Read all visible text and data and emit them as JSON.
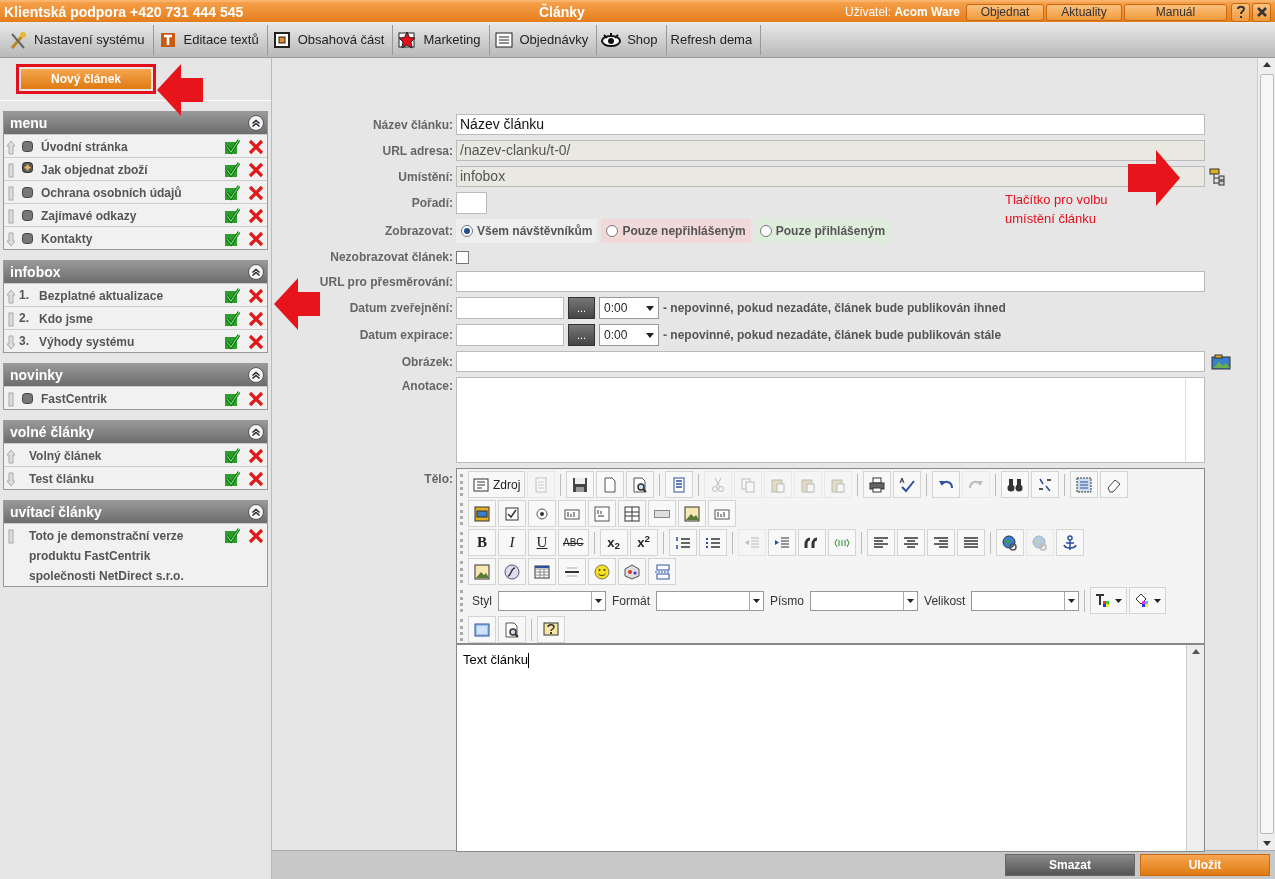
{
  "header": {
    "support": "Klientská podpora +420 731 444 545",
    "title": "Články",
    "user_label": "Uživatel:",
    "user_name": "Acom Ware",
    "buttons": [
      "Objednat",
      "Aktuality",
      "Manuál"
    ]
  },
  "menubar": [
    {
      "label": "Nastavení systému",
      "kind": "tools"
    },
    {
      "label": "Editace textů",
      "kind": "text"
    },
    {
      "label": "Obsahová část",
      "kind": "frame"
    },
    {
      "label": "Marketing",
      "kind": "star"
    },
    {
      "label": "Objednávky",
      "kind": "list"
    },
    {
      "label": "Shop",
      "kind": "eye"
    },
    {
      "label": "Refresh dema",
      "kind": "plain"
    }
  ],
  "new_button": "Nový článek",
  "groups": [
    {
      "title": "menu",
      "items": [
        {
          "kind": "bullet",
          "text": "Úvodní stránka"
        },
        {
          "kind": "plus",
          "text": "Jak objednat zboží"
        },
        {
          "kind": "bullet",
          "text": "Ochrana osobních údajů"
        },
        {
          "kind": "bullet",
          "text": "Zajímavé odkazy"
        },
        {
          "kind": "bullet",
          "text": "Kontakty"
        }
      ]
    },
    {
      "title": "infobox",
      "items": [
        {
          "kind": "number",
          "number": "1.",
          "text": "Bezplatné aktualizace"
        },
        {
          "kind": "number",
          "number": "2.",
          "text": "Kdo jsme"
        },
        {
          "kind": "number",
          "number": "3.",
          "text": "Výhody systému"
        }
      ]
    },
    {
      "title": "novinky",
      "items": [
        {
          "kind": "bullet",
          "text": "FastCentrik"
        }
      ]
    },
    {
      "title": "volné články",
      "items": [
        {
          "kind": "plain",
          "text": "Volný článek"
        },
        {
          "kind": "plain",
          "text": "Test článku"
        }
      ]
    },
    {
      "title": "uvítací články",
      "items": [
        {
          "kind": "plain",
          "text": "Toto je demonstrační verze produktu FastCentrik společnosti NetDirect s.r.o."
        }
      ]
    }
  ],
  "form": [
    {
      "kind": "text",
      "label": "Název článku:",
      "value": "Název článku"
    },
    {
      "kind": "readonly",
      "label": "URL adresa:",
      "value": "/nazev-clanku/t-0/"
    },
    {
      "kind": "location",
      "label": "Umístění:",
      "value": "infobox"
    },
    {
      "kind": "small",
      "label": "Pořadí:"
    },
    {
      "kind": "radio",
      "label": "Zobrazovat:",
      "options": [
        {
          "label": "Všem návštěvníkům",
          "selected": true,
          "color": "#eeeeee"
        },
        {
          "label": "Pouze nepřihlášeným",
          "selected": false,
          "color": "#f1d9d9"
        },
        {
          "label": "Pouze přihlášeným",
          "selected": false,
          "color": "#dfeedc"
        }
      ]
    },
    {
      "kind": "checkbox",
      "label": "Nezobrazovat článek:",
      "checked": false
    },
    {
      "kind": "text",
      "label": "URL pro přesměrování:"
    },
    {
      "kind": "date",
      "label": "Datum zveřejnění:",
      "button": "...",
      "time": "0:00",
      "note": "- nepovinné, pokud nezadáte, článek bude publikován ihned"
    },
    {
      "kind": "date",
      "label": "Datum expirace:",
      "button": "...",
      "time": "0:00",
      "note": "- nepovinné, pokud nezadáte, článek bude publikován stále"
    },
    {
      "kind": "image",
      "label": "Obrázek:"
    },
    {
      "kind": "textarea",
      "label": "Anotace:"
    }
  ],
  "callout": "Tlačítko pro volbu umístění článku",
  "editor": {
    "label": "Tělo:",
    "toolbar": [
      [
        {
          "kind": "source",
          "label": "Zdroj",
          "disabled": false
        },
        {
          "kind": "doc",
          "disabled": true
        },
        {
          "kind": "separator"
        },
        {
          "kind": "save",
          "disabled": false
        },
        {
          "kind": "page",
          "disabled": false
        },
        {
          "kind": "preview",
          "disabled": false
        },
        {
          "kind": "separator"
        },
        {
          "kind": "templates",
          "disabled": false
        },
        {
          "kind": "separator"
        },
        {
          "kind": "cut",
          "disabled": true
        },
        {
          "kind": "copy",
          "disabled": true
        },
        {
          "kind": "paste",
          "disabled": true
        },
        {
          "kind": "paste",
          "disabled": true
        },
        {
          "kind": "paste",
          "disabled": true
        },
        {
          "kind": "separator"
        },
        {
          "kind": "print",
          "disabled": false
        },
        {
          "kind": "spell",
          "disabled": false
        },
        {
          "kind": "separator"
        },
        {
          "kind": "undo",
          "disabled": false
        },
        {
          "kind": "redo",
          "disabled": true
        },
        {
          "kind": "separator"
        },
        {
          "kind": "find",
          "disabled": false
        },
        {
          "kind": "replace",
          "disabled": false
        },
        {
          "kind": "separator"
        },
        {
          "kind": "selectall",
          "disabled": false
        },
        {
          "kind": "eraser",
          "disabled": false
        }
      ],
      [
        {
          "kind": "form",
          "disabled": false
        },
        {
          "kind": "checkbox",
          "disabled": false
        },
        {
          "kind": "radio",
          "disabled": false
        },
        {
          "kind": "field",
          "disabled": false
        },
        {
          "kind": "textarea",
          "disabled": false
        },
        {
          "kind": "select",
          "disabled": false
        },
        {
          "kind": "bar",
          "disabled": false
        },
        {
          "kind": "image",
          "disabled": false
        },
        {
          "kind": "field",
          "disabled": false
        }
      ],
      [
        {
          "kind": "bold",
          "label": "B",
          "disabled": false
        },
        {
          "kind": "italic",
          "label": "I",
          "disabled": false
        },
        {
          "kind": "underline",
          "label": "U",
          "disabled": false
        },
        {
          "kind": "strike",
          "label": "ABC",
          "disabled": false
        },
        {
          "kind": "separator"
        },
        {
          "kind": "subscript",
          "label": "x$_{2}$",
          "disabled": false
        },
        {
          "kind": "superscript",
          "label": "x$^{2}$",
          "disabled": false
        },
        {
          "kind": "separator"
        },
        {
          "kind": "olist",
          "disabled": false
        },
        {
          "kind": "ulist",
          "disabled": false
        },
        {
          "kind": "separator"
        },
        {
          "kind": "outdent",
          "disabled": true
        },
        {
          "kind": "indent",
          "disabled": false
        },
        {
          "kind": "quote",
          "disabled": false
        },
        {
          "kind": "div",
          "disabled": false
        },
        {
          "kind": "separator"
        },
        {
          "kind": "left",
          "disabled": false
        },
        {
          "kind": "center",
          "disabled": false
        },
        {
          "kind": "right",
          "disabled": false
        },
        {
          "kind": "justify",
          "disabled": false
        },
        {
          "kind": "separator"
        },
        {
          "kind": "globe",
          "disabled": false
        },
        {
          "kind": "globe",
          "disabled": true
        },
        {
          "kind": "anchor",
          "disabled": false
        }
      ],
      [
        {
          "kind": "image",
          "disabled": false
        },
        {
          "kind": "flash",
          "disabled": false
        },
        {
          "kind": "table",
          "disabled": false
        },
        {
          "kind": "rule",
          "disabled": false
        },
        {
          "kind": "smiley",
          "disabled": false
        },
        {
          "kind": "cube",
          "disabled": false
        },
        {
          "kind": "pagebreak",
          "disabled": false
        }
      ],
      [
        {
          "kind": "combo",
          "label": "Styl"
        },
        {
          "kind": "combo",
          "label": "Formát"
        },
        {
          "kind": "combo",
          "label": "Písmo"
        },
        {
          "kind": "combo",
          "label": "Velikost"
        },
        {
          "kind": "separator"
        },
        {
          "kind": "color",
          "disabled": false
        },
        {
          "kind": "fill",
          "disabled": false
        }
      ],
      [
        {
          "kind": "maximize",
          "disabled": false
        },
        {
          "kind": "preview",
          "disabled": false
        },
        {
          "kind": "separator"
        },
        {
          "kind": "help",
          "disabled": false
        }
      ]
    ],
    "body": "Text článku"
  },
  "footer": {
    "buttons": [
      {
        "label": "Smazat",
        "kind": "secondary"
      },
      {
        "label": "Uložit",
        "kind": "primary"
      }
    ]
  }
}
